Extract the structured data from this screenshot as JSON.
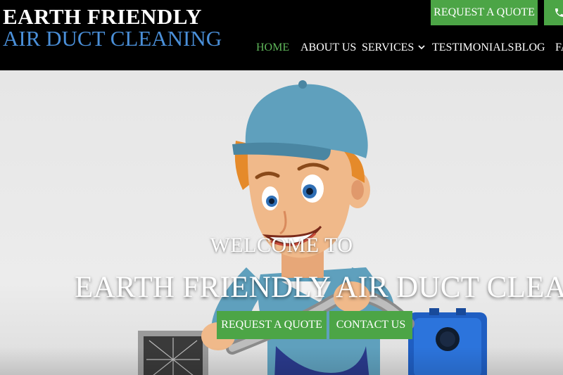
{
  "header": {
    "logo_line1": "EARTH FRIENDLY",
    "logo_line2": "AIR DUCT CLEANING",
    "quote_button": "REQUEST A QUOTE",
    "phone_icon": "phone-icon"
  },
  "nav": {
    "items": [
      {
        "label": "HOME",
        "active": true
      },
      {
        "label": "ABOUT US"
      },
      {
        "label": "SERVICES",
        "has_dropdown": true
      },
      {
        "label": "TESTIMONIALS"
      },
      {
        "label": "BLOG"
      },
      {
        "label": "FA"
      }
    ]
  },
  "hero": {
    "welcome": "WELCOME TO",
    "headline": "EARTH FRIENDLY AIR DUCT CLEANING",
    "buttons": {
      "quote": "REQUEST A QUOTE",
      "contact": "CONTACT US"
    }
  },
  "colors": {
    "accent_green": "#4ca546",
    "nav_active": "#5fb75a",
    "logo_blue": "#4a8fd8",
    "header_bg": "#000000"
  }
}
